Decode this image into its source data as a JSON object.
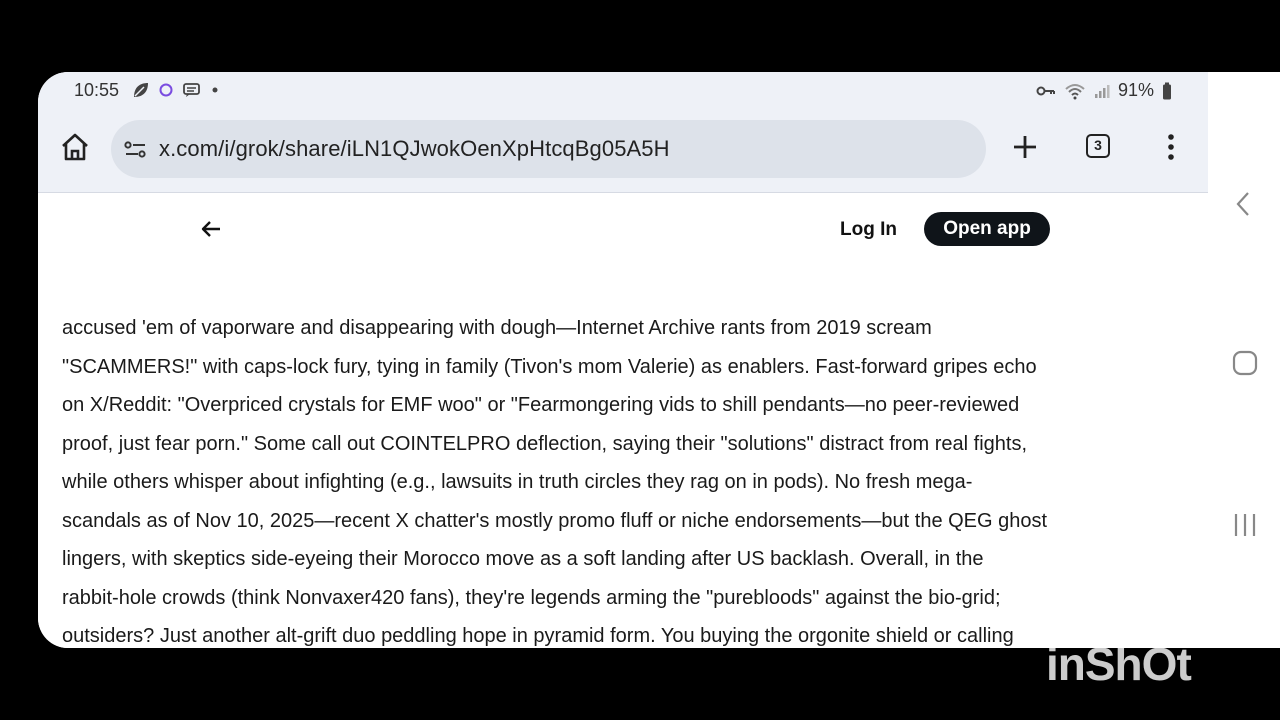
{
  "status_bar": {
    "time": "10:55",
    "battery": "91%",
    "icons": [
      "leaf-icon",
      "messenger-icon",
      "chat-icon",
      "dot-icon",
      "key-icon",
      "wifi-icon",
      "signal-icon",
      "battery-icon"
    ]
  },
  "browser": {
    "url": "x.com/i/grok/share/iLN1QJwokOenXpHtcqBg05A5H",
    "tab_count": "3"
  },
  "page": {
    "login_label": "Log In",
    "open_app_label": "Open app",
    "lines": [
      "accused 'em of vaporware and disappearing with dough—Internet Archive rants from 2019 scream",
      "\"SCAMMERS!\" with caps-lock fury, tying in family (Tivon's mom Valerie) as enablers. Fast-forward gripes echo",
      "on X/Reddit: \"Overpriced crystals for EMF woo\" or \"Fearmongering vids to shill pendants—no peer-reviewed",
      "proof, just fear porn.\" Some call out COINTELPRO deflection, saying their \"solutions\" distract from real fights,",
      "while others whisper about infighting (e.g., lawsuits in truth circles they rag on in pods). No fresh mega-",
      "scandals as of Nov 10, 2025—recent X chatter's mostly promo fluff or niche endorsements—but the QEG ghost",
      "lingers, with skeptics side-eyeing their Morocco move as a soft landing after US backlash. Overall, in the",
      "rabbit-hole crowds (think Nonvaxer420 fans), they're legends arming the \"purebloods\" against the bio-grid;",
      "outsiders? Just another alt-grift duo peddling hope in pyramid form. You buying the orgonite shield or calling"
    ]
  },
  "watermark": "inShOt"
}
